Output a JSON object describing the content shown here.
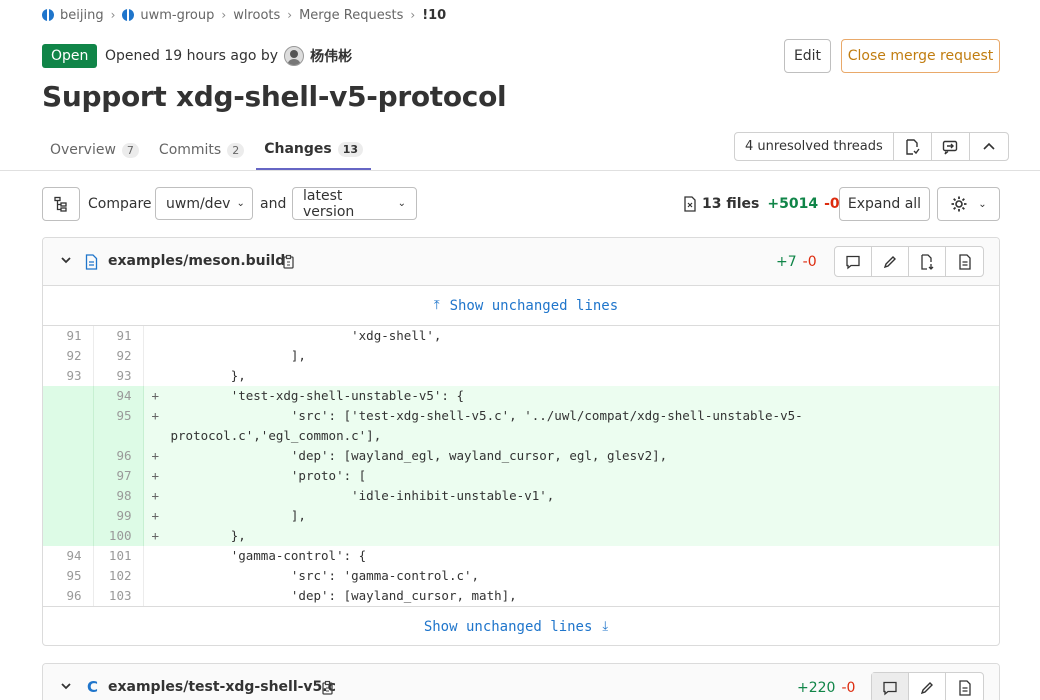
{
  "breadcrumb": [
    {
      "label": "beijing",
      "icon": "group-icon"
    },
    {
      "label": "uwm-group",
      "icon": "group-icon"
    },
    {
      "label": "wlroots",
      "icon": ""
    },
    {
      "label": "Merge Requests",
      "icon": ""
    },
    {
      "label": "!10",
      "icon": ""
    }
  ],
  "header": {
    "status": "Open",
    "opened_prefix": "Opened 19 hours ago by",
    "author": "杨伟彬",
    "edit_label": "Edit",
    "close_label": "Close merge request",
    "title": "Support xdg-shell-v5-protocol"
  },
  "tabs": [
    {
      "label": "Overview",
      "count": "7"
    },
    {
      "label": "Commits",
      "count": "2"
    },
    {
      "label": "Changes",
      "count": "13"
    }
  ],
  "threads": {
    "label": "4 unresolved threads"
  },
  "compare": {
    "label": "Compare",
    "source": "uwm/dev",
    "and": "and",
    "target": "latest version",
    "files": "13 files",
    "added": "+5014",
    "removed": "-0",
    "expand_label": "Expand all"
  },
  "files": [
    {
      "name": "examples/meson.build",
      "added": "+7",
      "removed": "-0",
      "show_unchanged": "Show unchanged lines",
      "lines": [
        {
          "old": "91",
          "new": "91",
          "type": "ctx",
          "code": "                        'xdg-shell',"
        },
        {
          "old": "92",
          "new": "92",
          "type": "ctx",
          "code": "                ],"
        },
        {
          "old": "93",
          "new": "93",
          "type": "ctx",
          "code": "        },"
        },
        {
          "old": "",
          "new": "94",
          "type": "add",
          "code": "        'test-xdg-shell-unstable-v5': {"
        },
        {
          "old": "",
          "new": "95",
          "type": "add",
          "code": "                'src': ['test-xdg-shell-v5.c', '../uwl/compat/xdg-shell-unstable-v5-"
        },
        {
          "old": "",
          "new": "",
          "type": "add",
          "code": "protocol.c','egl_common.c'],"
        },
        {
          "old": "",
          "new": "96",
          "type": "add",
          "code": "                'dep': [wayland_egl, wayland_cursor, egl, glesv2],"
        },
        {
          "old": "",
          "new": "97",
          "type": "add",
          "code": "                'proto': ["
        },
        {
          "old": "",
          "new": "98",
          "type": "add",
          "code": "                        'idle-inhibit-unstable-v1',"
        },
        {
          "old": "",
          "new": "99",
          "type": "add",
          "code": "                ],"
        },
        {
          "old": "",
          "new": "100",
          "type": "add",
          "code": "        },"
        },
        {
          "old": "94",
          "new": "101",
          "type": "ctx",
          "code": "        'gamma-control': {"
        },
        {
          "old": "95",
          "new": "102",
          "type": "ctx",
          "code": "                'src': 'gamma-control.c',"
        },
        {
          "old": "96",
          "new": "103",
          "type": "ctx",
          "code": "                'dep': [wayland_cursor, math],"
        }
      ]
    },
    {
      "name": "examples/test-xdg-shell-v5.c",
      "added": "+220",
      "removed": "-0",
      "type_icon": "C"
    }
  ]
}
